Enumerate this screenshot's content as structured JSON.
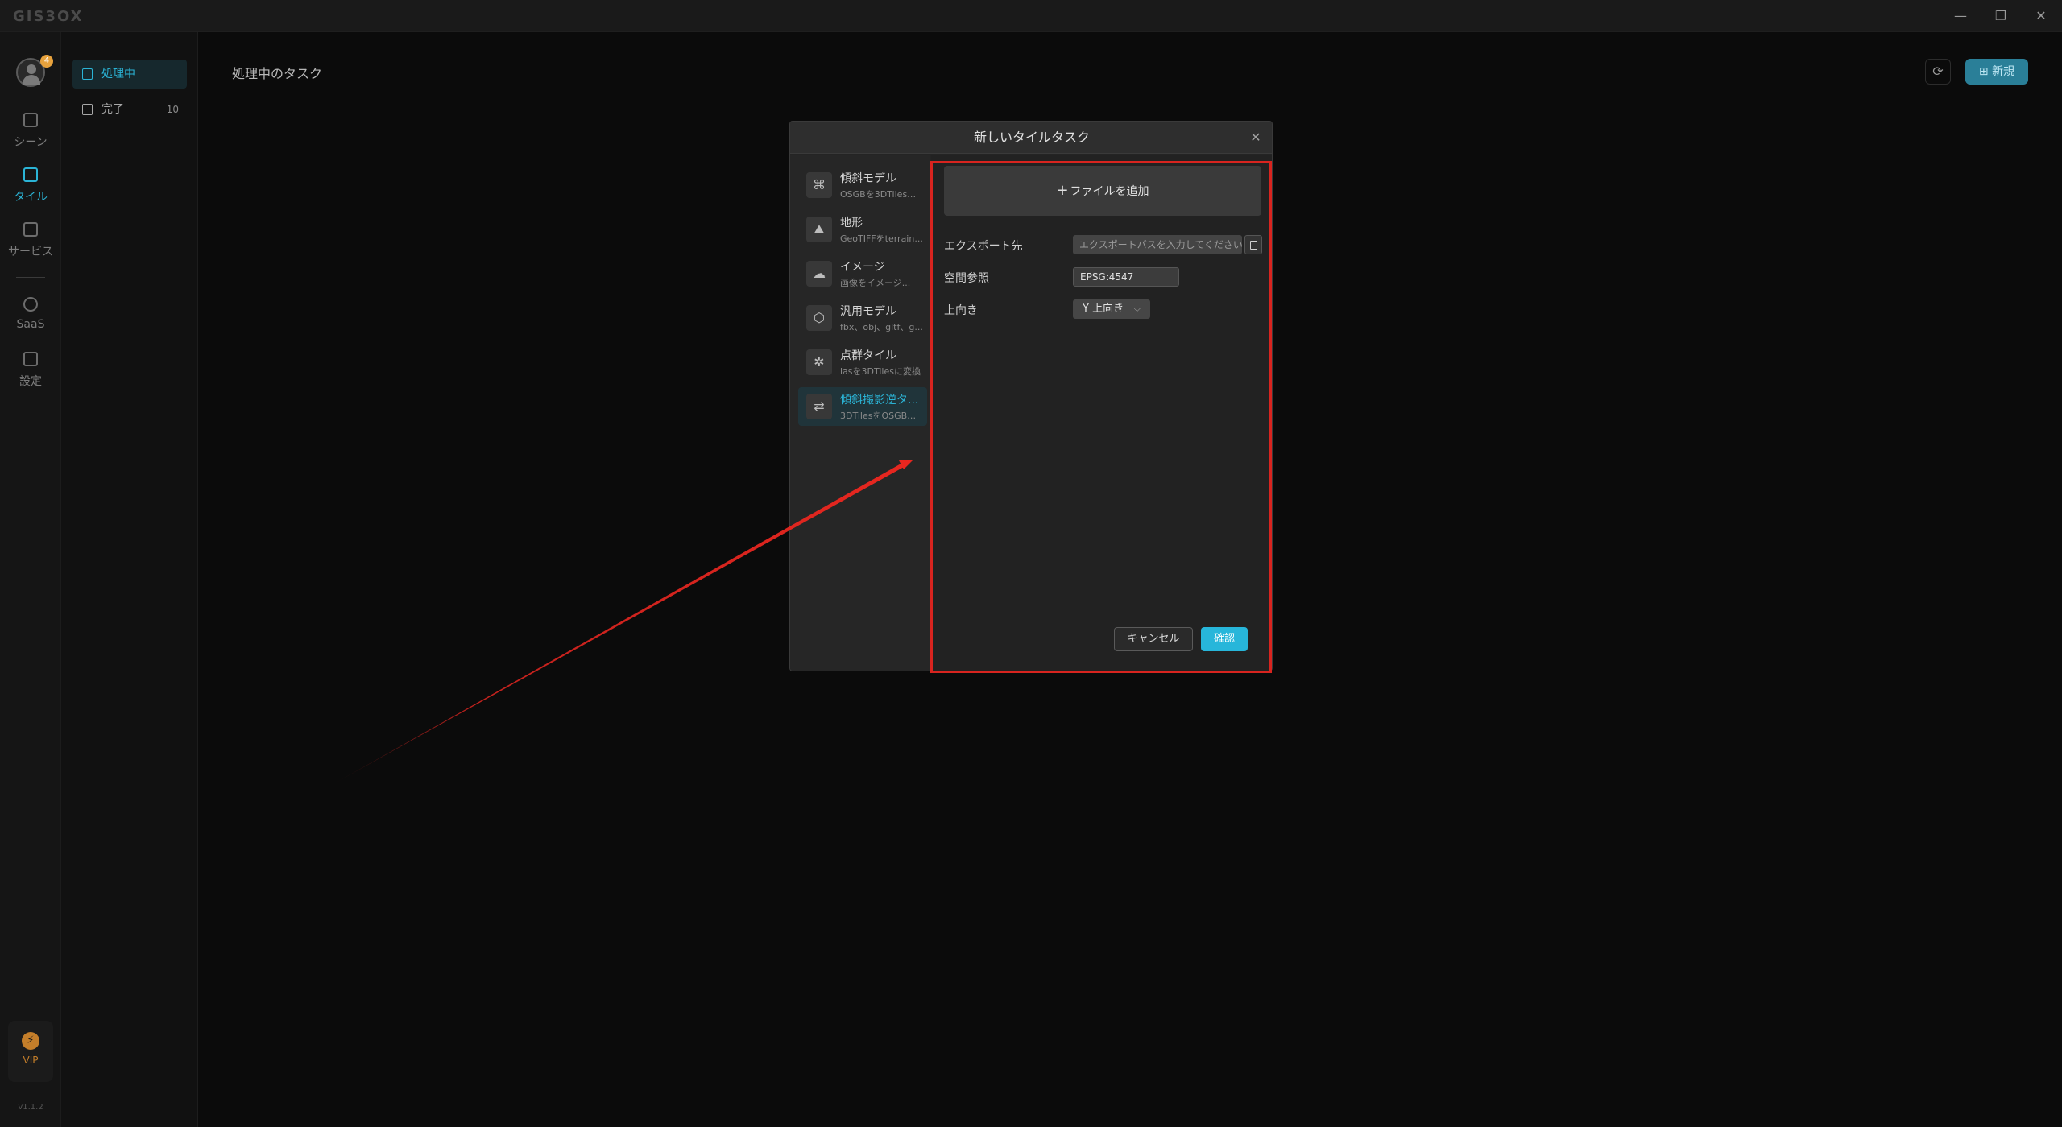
{
  "app": {
    "logo": "GIS3OX",
    "window_controls": {
      "minimize": "—",
      "restore": "❐",
      "close": "✕"
    }
  },
  "rail": {
    "avatar_badge": "4",
    "items": [
      {
        "label": "シーン",
        "icon": "scene-icon"
      },
      {
        "label": "タイル",
        "icon": "tile-icon",
        "active": true
      },
      {
        "label": "サービス",
        "icon": "service-icon"
      },
      {
        "label": "SaaS",
        "icon": "saas-icon"
      },
      {
        "label": "設定",
        "icon": "settings-icon"
      }
    ],
    "vip_label": "VIP",
    "vip_icon": "⚡",
    "version": "v1.1.2"
  },
  "subnav": {
    "items": [
      {
        "label": "処理中",
        "active": true
      },
      {
        "label": "完了",
        "count": "10"
      }
    ]
  },
  "main": {
    "title": "処理中のタスク",
    "refresh_icon": "⟳",
    "new_label": "新規",
    "new_icon": "⊞"
  },
  "modal": {
    "title": "新しいタイルタスク",
    "close": "✕",
    "types": [
      {
        "name": "傾斜モデル",
        "desc": "OSGBを3DTilesに...",
        "icon": "⌘"
      },
      {
        "name": "地形",
        "desc": "GeoTIFFをterrain...",
        "icon": "⛰"
      },
      {
        "name": "イメージ",
        "desc": "画像をイメージ...",
        "icon": "☁"
      },
      {
        "name": "汎用モデル",
        "desc": "fbx、obj、gltf、g...",
        "icon": "⬡"
      },
      {
        "name": "点群タイル",
        "desc": "lasを3DTilesに変換",
        "icon": "✲"
      },
      {
        "name": "傾斜撮影逆タ...",
        "desc": "3DTilesをOSGBに...",
        "icon": "⇄",
        "active": true
      }
    ],
    "add_file": {
      "plus": "+",
      "label": "ファイルを追加"
    },
    "export": {
      "label": "エクスポート先",
      "placeholder": "エクスポートパスを入力してください"
    },
    "srs": {
      "label": "空間参照",
      "value": "EPSG:4547"
    },
    "up_axis": {
      "label": "上向き",
      "value": "Y 上向き",
      "chevron": "⌵"
    },
    "cancel": "キャンセル",
    "confirm": "確認"
  },
  "colors": {
    "accent": "#2bb4d6",
    "annotation": "#d8241f",
    "vip": "#c47e2a"
  }
}
